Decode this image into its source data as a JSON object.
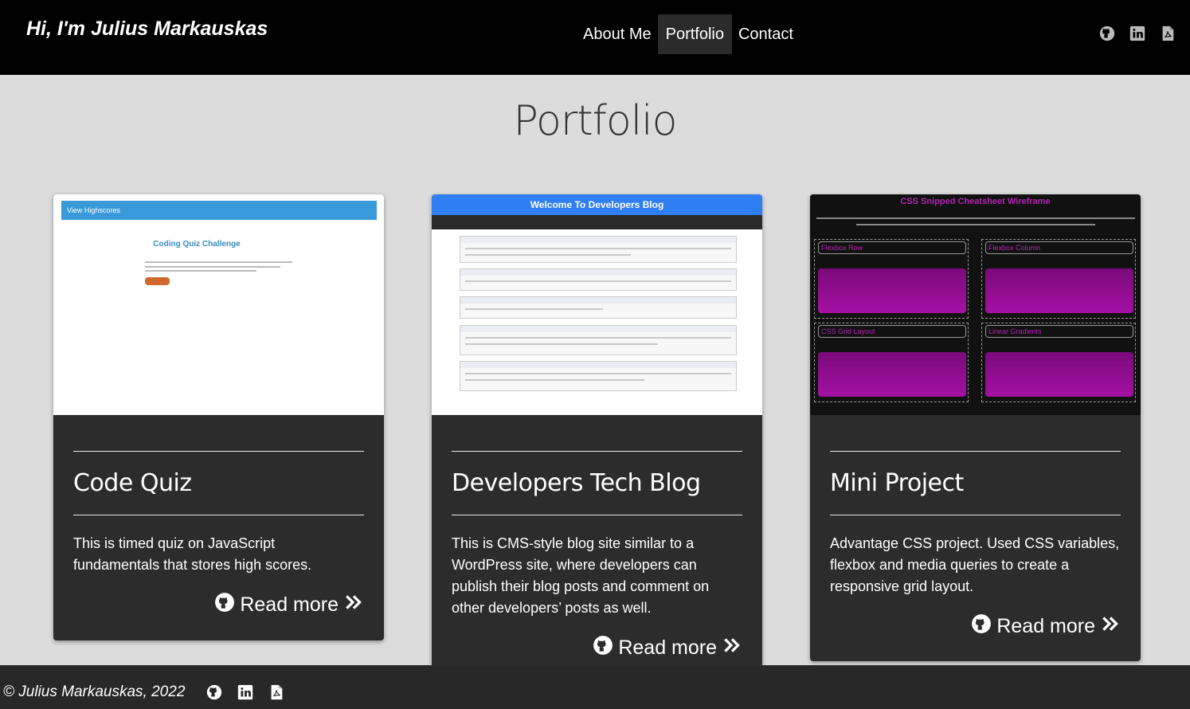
{
  "header": {
    "brand": "Hi, I'm Julius Markauskas",
    "nav": [
      {
        "label": "About Me",
        "active": false
      },
      {
        "label": "Portfolio",
        "active": true
      },
      {
        "label": "Contact",
        "active": false
      }
    ],
    "icons": [
      "github-icon",
      "linkedin-icon",
      "pdf-icon"
    ]
  },
  "main": {
    "title": "Portfolio",
    "cards": [
      {
        "title": "Code Quiz",
        "description": "This is timed quiz on JavaScript fundamentals that stores high scores.",
        "link": "Read more",
        "thumb": {
          "bar": "View Highscores",
          "heading": "Coding Quiz Challenge"
        }
      },
      {
        "title": "Developers Tech Blog",
        "description": "This is CMS-style blog site similar to a WordPress site, where developers can publish their blog posts and comment on other developers’ posts as well.",
        "link": "Read more",
        "thumb": {
          "heading": "Welcome To Developers Blog"
        }
      },
      {
        "title": "Mini Project",
        "description": "Advantage CSS project. Used CSS variables, flexbox and media queries to create a responsive grid layout.",
        "link": "Read more",
        "thumb": {
          "heading": "CSS Snipped Cheatsheet Wireframe",
          "labels": [
            "Flexbox Row",
            "Flexbox Column",
            "CSS Grid Layout",
            "Linear Gradients"
          ]
        }
      }
    ]
  },
  "footer": {
    "copyright": "© Julius Markauskas, 2022",
    "icons": [
      "github-icon",
      "linkedin-icon",
      "pdf-icon"
    ]
  },
  "colors": {
    "header_bg": "#000000",
    "page_bg": "#dcdcdc",
    "card_bg": "#2c2c2c",
    "footer_bg": "#282828",
    "active_nav_bg": "#2b2b2b"
  }
}
